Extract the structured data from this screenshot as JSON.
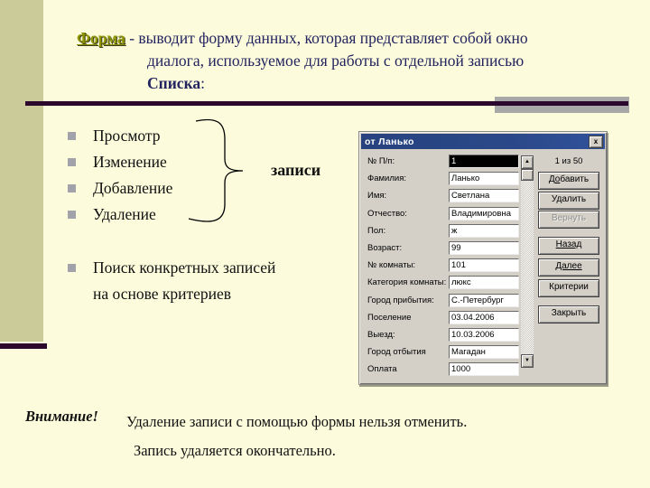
{
  "colors": {
    "slide_bg": "#FCFCDC",
    "sidebar": "#CBCB9A",
    "divider": "#2D082D",
    "divider_gray": "#A8A8A8",
    "term": "#8F9500",
    "title_text": "#23235F",
    "dialog_titlebar": "#2A4888",
    "dialog_bg": "#D4D0C8"
  },
  "title": {
    "term": "Форма",
    "after_term": " - выводит форму данных, которая представляет собой окно",
    "line2": "диалога, используемое для работы с отдельной записью",
    "line3_bold": "Списка",
    "line3_tail": ":"
  },
  "bullets": {
    "items": [
      "Просмотр",
      "Изменение",
      "Добавление",
      "Удаление"
    ],
    "brace_label": "записи",
    "search_line1": "Поиск конкретных записей",
    "search_line2": "на основе критериев"
  },
  "warning": {
    "label": "Внимание!",
    "line1": "Удаление записи с помощью формы нельзя отменить.",
    "line2": "Запись удаляется окончательно."
  },
  "dialog": {
    "title": "от Ланько",
    "close_label": "x",
    "counter": "1 из 50",
    "scrollbar": {
      "up": "▲",
      "down": "▼"
    },
    "fields": [
      {
        "label": "№ П/п:",
        "value": "1"
      },
      {
        "label": "Фамилия:",
        "value": "Ланько"
      },
      {
        "label": "Имя:",
        "value": "Светлана"
      },
      {
        "label": "Отчество:",
        "value": "Владимировна"
      },
      {
        "label": "Пол:",
        "value": "ж"
      },
      {
        "label": "Возраст:",
        "value": "99"
      },
      {
        "label": "№ комнаты:",
        "value": "101"
      },
      {
        "label": "Категория комнаты:",
        "value": "люкс"
      },
      {
        "label": "Город прибытия:",
        "value": "С.-Петербург"
      },
      {
        "label": "Поселение",
        "value": "03.04.2006"
      },
      {
        "label": "Выезд:",
        "value": "10.03.2006"
      },
      {
        "label": "Город отбытия",
        "value": "Магадан"
      },
      {
        "label": "Оплата",
        "value": "1000"
      }
    ],
    "buttons": [
      {
        "pre": "Д",
        "u": "о",
        "post": "бавить"
      },
      {
        "label": "Удалить"
      },
      {
        "label": "Вернуть",
        "disabled": true
      },
      {
        "label": "Назад",
        "underline": true
      },
      {
        "label": "Далее",
        "underline": true
      },
      {
        "label": "Критерии"
      },
      {
        "label": "Закрыть"
      }
    ]
  }
}
